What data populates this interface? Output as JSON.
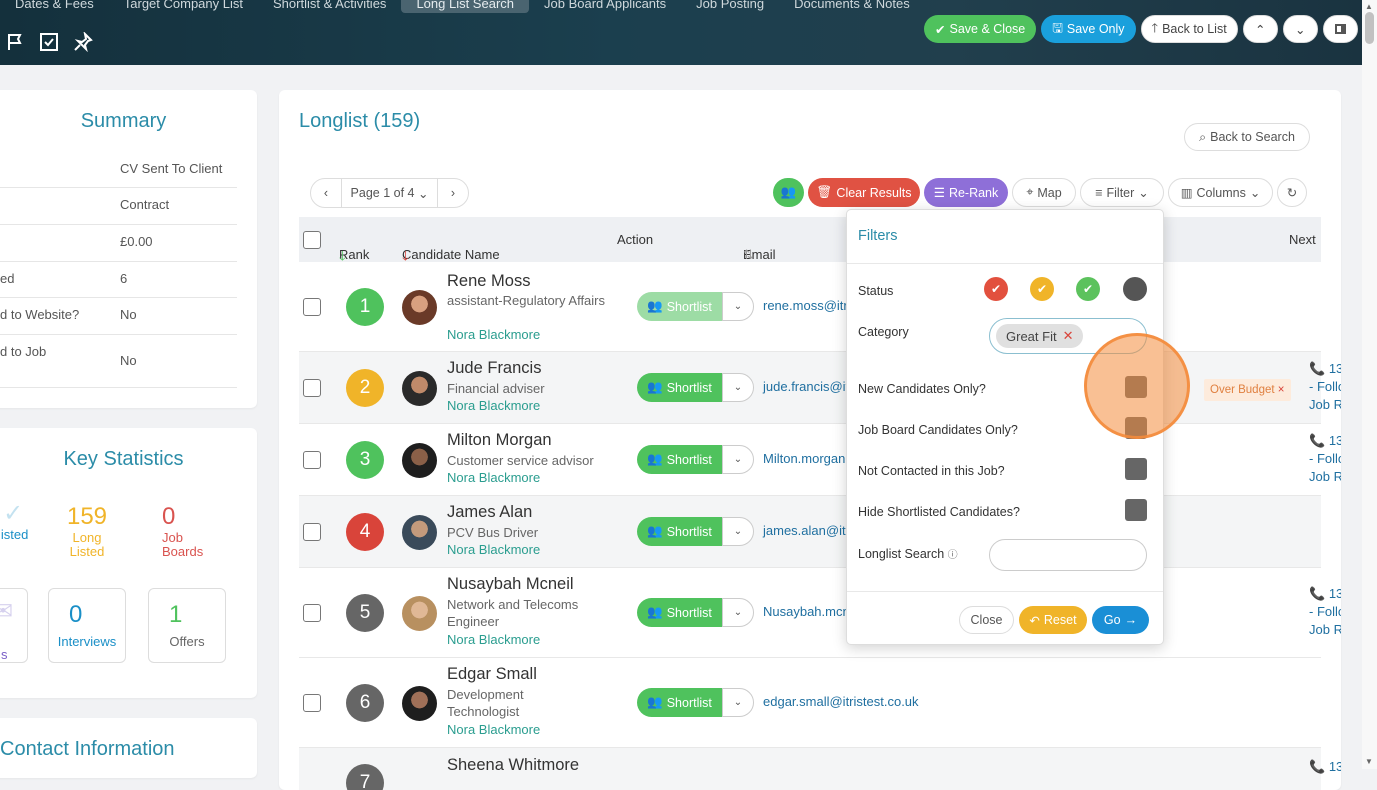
{
  "tabs": [
    "Dates & Fees",
    "Target Company List",
    "Shortlist & Activities",
    "Long List Search",
    "Job Board Applicants",
    "Job Posting",
    "Documents & Notes"
  ],
  "toolbar_icons": [
    "flag-icon",
    "check-square-icon",
    "pin-icon"
  ],
  "header_buttons": {
    "save_close": "Save & Close",
    "save_only": "Save Only",
    "back_to_list": "Back to List"
  },
  "summary": {
    "title": "Summary",
    "rows": [
      {
        "k": "",
        "v": "CV Sent To Client"
      },
      {
        "k": "",
        "v": "Contract"
      },
      {
        "k": "",
        "v": "£0.00"
      },
      {
        "k": "ed",
        "v": "6"
      },
      {
        "k": "d to Website?",
        "v": "No"
      },
      {
        "k": "d to Job",
        "v": "No"
      }
    ]
  },
  "stats": {
    "title": "Key Statistics",
    "listed_label": "listed",
    "long_listed": {
      "num": "159",
      "label1": "Long",
      "label2": "Listed"
    },
    "job_boards": {
      "num": "0",
      "label1": "Job",
      "label2": "Boards"
    },
    "s_label": "s",
    "interviews": {
      "num": "0",
      "label": "Interviews"
    },
    "offers": {
      "num": "1",
      "label": "Offers"
    },
    "colors": {
      "long": "#f0b429",
      "jobboards": "#d9534f",
      "interviews": "#1a8fc7",
      "offers": "#4fc25d"
    }
  },
  "contact": {
    "title": "Contact Information"
  },
  "longlist": {
    "title": "Longlist (159)",
    "back_to_search": "Back to Search",
    "page_label": "Page 1 of 4",
    "buttons": {
      "clear": "Clear Results",
      "rerank": "Re-Rank",
      "map": "Map",
      "filter": "Filter",
      "columns": "Columns"
    },
    "headers": {
      "rank": "Rank",
      "name": "Candidate Name",
      "action": "Action",
      "email": "Email",
      "next": "Next"
    },
    "rows": [
      {
        "rank": "1",
        "color": "#4fc25d",
        "name": "Rene Moss",
        "title": "assistant-Regulatory Affairs",
        "owner": "Nora Blackmore",
        "action": "Shortlist",
        "email": "rene.moss@itrist",
        "next1": "",
        "next2": "",
        "next3": ""
      },
      {
        "rank": "2",
        "color": "#f0b429",
        "name": "Jude Francis",
        "title": "Financial adviser",
        "owner": "Nora Blackmore",
        "action": "Shortlist",
        "email": "jude.francis@itris",
        "next1": "13",
        "next2": "- Follo",
        "next3": "Job R"
      },
      {
        "rank": "3",
        "color": "#4fc25d",
        "name": "Milton Morgan",
        "title": "Customer service advisor",
        "owner": "Nora Blackmore",
        "action": "Shortlist",
        "email": "Milton.morgan@i",
        "next1": "13",
        "next2": "- Follo",
        "next3": "Job R"
      },
      {
        "rank": "4",
        "color": "#d9443a",
        "name": "James Alan",
        "title": "PCV Bus Driver",
        "owner": "Nora Blackmore",
        "action": "Shortlist",
        "email": "james.alan@itrist",
        "next1": "",
        "next2": "",
        "next3": ""
      },
      {
        "rank": "5",
        "color": "#666666",
        "name": "Nusaybah Mcneil",
        "title": "Network and Telecoms Engineer",
        "owner": "Nora Blackmore",
        "action": "Shortlist",
        "email": "Nusaybah.mcnei",
        "next1": "13",
        "next2": "- Follo",
        "next3": "Job R"
      },
      {
        "rank": "6",
        "color": "#666666",
        "name": "Edgar Small",
        "title": "Development Technologist",
        "owner": "Nora Blackmore",
        "action": "Shortlist",
        "email": "edgar.small@itristest.co.uk",
        "next1": "",
        "next2": "",
        "next3": ""
      },
      {
        "rank": "7",
        "color": "#666666",
        "name": "Sheena Whitmore",
        "title": "",
        "owner": "",
        "action": "",
        "email": "",
        "next1": "13",
        "next2": "",
        "next3": ""
      }
    ],
    "over_budget_tag": "Over Budget"
  },
  "filters": {
    "title": "Filters",
    "status_label": "Status",
    "status_colors": [
      "#e2503e",
      "#f0b429",
      "#5cc25d",
      "#555555"
    ],
    "category_label": "Category",
    "category_chip": "Great Fit",
    "new_candidates": "New Candidates Only?",
    "job_board": "Job Board Candidates Only?",
    "not_contacted": "Not Contacted in this Job?",
    "hide_shortlisted": "Hide Shortlisted Candidates?",
    "longlist_search": "Longlist Search",
    "longlist_search_value": "",
    "close": "Close",
    "reset": "Reset",
    "go": "Go"
  }
}
